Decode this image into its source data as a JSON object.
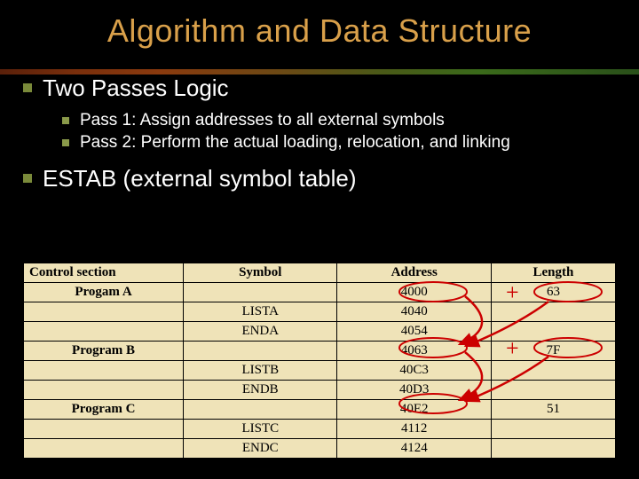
{
  "title": "Algorithm and Data Structure",
  "bullets": {
    "b1": "Two Passes Logic",
    "b1_children": {
      "c1": "Pass 1: Assign addresses to all external symbols",
      "c2": "Pass 2: Perform the actual loading, relocation, and linking"
    },
    "b2": "ESTAB (external symbol table)"
  },
  "table": {
    "headers": {
      "cs": "Control section",
      "sym": "Symbol",
      "addr": "Address",
      "len": "Length"
    },
    "rows": {
      "r0": {
        "cs": "Progam A",
        "sym": "",
        "addr": "4000",
        "len": "63"
      },
      "r1": {
        "cs": "",
        "sym": "LISTA",
        "addr": "4040",
        "len": ""
      },
      "r2": {
        "cs": "",
        "sym": "ENDA",
        "addr": "4054",
        "len": ""
      },
      "r3": {
        "cs": "Program B",
        "sym": "",
        "addr": "4063",
        "len": "7F"
      },
      "r4": {
        "cs": "",
        "sym": "LISTB",
        "addr": "40C3",
        "len": ""
      },
      "r5": {
        "cs": "",
        "sym": "ENDB",
        "addr": "40D3",
        "len": ""
      },
      "r6": {
        "cs": "Program C",
        "sym": "",
        "addr": "40E2",
        "len": "51"
      },
      "r7": {
        "cs": "",
        "sym": "LISTC",
        "addr": "4112",
        "len": ""
      },
      "r8": {
        "cs": "",
        "sym": "ENDC",
        "addr": "4124",
        "len": ""
      }
    }
  },
  "annotations": {
    "plus1": "+",
    "plus2": "+"
  }
}
